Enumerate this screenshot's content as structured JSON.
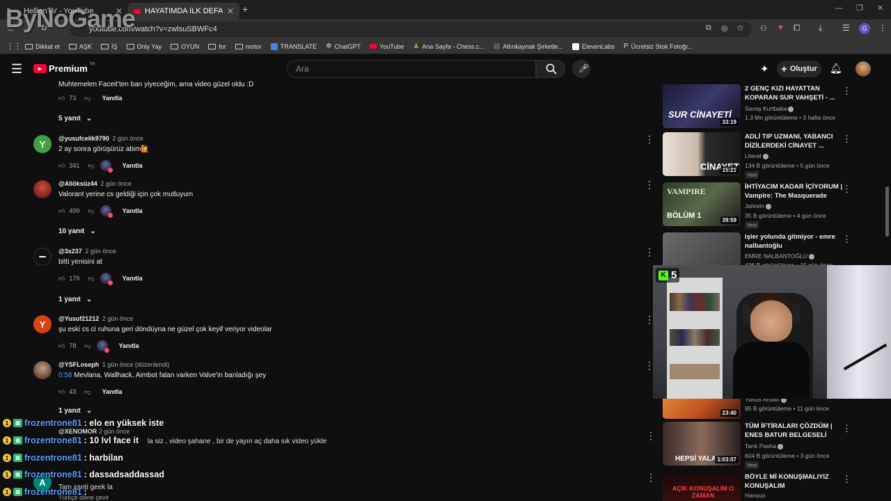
{
  "browser": {
    "tabs": [
      {
        "label": "HellianTV - YouTube",
        "active": false
      },
      {
        "label": "HAYATIMDA İLK DEFA HİLE KUL",
        "active": true
      }
    ],
    "url": "youtube.com/watch?v=zwlsuSBWFc4",
    "profile_initial": "G",
    "bookmarks": [
      "Dikkat et",
      "AŞK",
      "İŞ",
      "Only Yay",
      "OYUN",
      "for",
      "motor",
      "TRANSLATE",
      "ChatGPT",
      "YouTube",
      "Ana Sayfa - Chess.c...",
      "Altınkaynak Şirketle...",
      "ElevenLabs",
      "Ücretsiz Stok Fotoğr..."
    ]
  },
  "watermark": "ByNoGame",
  "youtube": {
    "logo_text": "Premium",
    "logo_region": "TR",
    "search_placeholder": "Ara",
    "create_label": "Oluştur"
  },
  "comments": {
    "partial_text": "Muhtemelen Faceit'ten ban yiyeceğim, ama video güzel oldu :D",
    "partial_likes": "73",
    "reply_label": "Yanıtla",
    "partial_replies": "5 yanıt",
    "items": [
      {
        "initial": "Y",
        "color": "#43a047",
        "author": "@yusufcelik9790",
        "time": "2 gün önce",
        "text": "2 ay sonra görüşürüz abim🙋",
        "likes": "341",
        "replies": ""
      },
      {
        "initial": "",
        "color": "#b8322a",
        "author": "@Aliöksüz44",
        "time": "2 gün önce",
        "text": "Valorant yerine cs geldiği için çok mutluyum",
        "likes": "499",
        "replies": "10 yanıt"
      },
      {
        "initial": "",
        "color": "#111111",
        "author": "@3x237",
        "time": "2 gün önce",
        "text": "bitti yenisini at",
        "likes": "179",
        "replies": "1 yanıt"
      },
      {
        "initial": "Y",
        "color": "#d84315",
        "author": "@Yusuf21212",
        "time": "2 gün önce",
        "text": "şu eski cs ci ruhuna geri döndüyna ne güzel çok keyif veriyor videolar",
        "likes": "78",
        "replies": ""
      },
      {
        "initial": "",
        "color": "#8a6a5a",
        "author": "@YSFLoseph",
        "time": "1 gün önce (düzenlendi)",
        "timestamp": "0:58",
        "text": "Mevlana, Wallhack, Aimbot falan varken Valve'in banladığı şey",
        "likes": "43",
        "replies": "1 yanıt"
      }
    ],
    "hidden_author": "@XENOMOR",
    "hidden_time": "2 gün önce",
    "hidden_text": "la siz , video şahane , bir de yayın aç daha sık video yükle",
    "last_avatar": "A",
    "last_text": "Tam xanti geek la",
    "last_text2": "Türkçe diline çevir"
  },
  "sidebar": {
    "videos": [
      {
        "title": "2 GENÇ KIZI HAYATTAN KOPARAN SUR VAHŞETİ - ...",
        "channel": "Savaş Kurtbaba",
        "meta": "1,3 Mn görüntüleme • 3 hafta önce",
        "duration": "33:19",
        "thumb_text": "SUR CİNAYETİ",
        "is_new": false
      },
      {
        "title": "ADLİ TIP UZMANI, YABANCI DİZİLERDEKİ CİNAYET ...",
        "channel": "Literat",
        "meta": "134 B görüntüleme • 5 gün önce",
        "duration": "15:21",
        "thumb_text": "CİNAYET",
        "is_new": true
      },
      {
        "title": "İHTİYACIM KADAR İÇİYORUM | Vampire: The Masquerade",
        "channel": "Jahrein",
        "meta": "35 B görüntüleme • 4 gün önce",
        "duration": "39:59",
        "thumb_text": "BÖLÜM 1",
        "is_new": true
      },
      {
        "title": "işler yolunda gitmiyor - emre nalbantoğlu",
        "channel": "EMRE NALBANTOĞLU",
        "meta": "436 B görüntüleme • 15 gün önce",
        "duration": "",
        "thumb_text": "",
        "is_new": false
      },
      {
        "title": "",
        "channel": "Yunus Arslan",
        "meta": "95 B görüntüleme • 11 gün önce",
        "duration": "23:40",
        "thumb_text": "",
        "is_new": false
      },
      {
        "title": "TÜM İFTİRALARI ÇÖZDÜM | ENES BATUR BELGESELİ",
        "channel": "Tarık Pasha",
        "meta": "604 B görüntüleme • 3 gün önce",
        "duration": "1:03:07",
        "thumb_text": "HEPSİ YALAN",
        "is_new": true
      },
      {
        "title": "BÖYLE Mİ KONUŞMALIYIZ KONUŞALIM",
        "channel": "Hansuo",
        "meta": "",
        "duration": "",
        "thumb_text": "AÇIK KONUŞALIM O ZAMAN",
        "is_new": false
      }
    ],
    "new_badge": "Yeni"
  },
  "webcam": {
    "kick_count": "5"
  },
  "chat": [
    {
      "user": "frozentrone81",
      "message": ": elo en yüksek iste"
    },
    {
      "user": "frozentrone81",
      "message": ": 10 lvl face it"
    },
    {
      "user": "frozentrone81",
      "message": ": harbilan"
    },
    {
      "user": "frozentrone81",
      "message": ": dassadsaddassad"
    },
    {
      "user": "frozentrone81",
      "message": ":"
    }
  ]
}
